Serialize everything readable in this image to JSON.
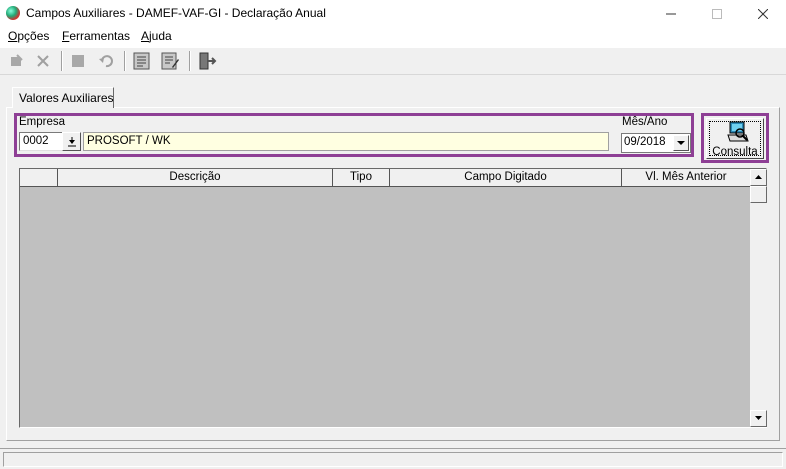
{
  "window": {
    "title": "Campos Auxiliares - DAMEF-VAF-GI - Declaração Anual",
    "min_glyph": "—",
    "max_glyph": "☐",
    "close_glyph": "✕"
  },
  "menu": {
    "items": [
      {
        "underline": "O",
        "rest": "pções"
      },
      {
        "underline": "F",
        "rest": "erramentas"
      },
      {
        "underline": "A",
        "rest": "juda"
      }
    ]
  },
  "toolbar": {
    "icons": [
      "edit-icon",
      "delete-icon",
      "stop-icon",
      "undo-icon",
      "report-icon",
      "report-edit-icon",
      "exit-icon"
    ]
  },
  "tabs": [
    {
      "label": "Valores Auxiliares"
    }
  ],
  "filter": {
    "empresa_label": "Empresa",
    "empresa_code": "0002",
    "empresa_name": "PROSOFT / WK",
    "mesano_label": "Mês/Ano",
    "mesano_value": "09/2018"
  },
  "consulta": {
    "label": "Consulta"
  },
  "grid": {
    "columns": [
      "",
      "Descrição",
      "Tipo",
      "Campo Digitado",
      "Vl. Mês Anterior"
    ],
    "rows": []
  },
  "colors": {
    "highlight_border": "#8e3f95",
    "readonly_field": "#ffffe1",
    "grid_background": "#c0c0c0"
  }
}
